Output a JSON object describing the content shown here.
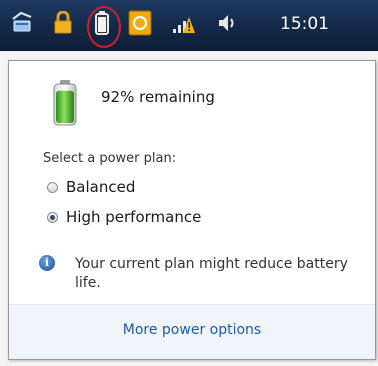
{
  "taskbar": {
    "clock": "15:01",
    "tray_icons": [
      "network-icon",
      "lock-icon",
      "battery-icon",
      "notification-icon",
      "signal-icon",
      "volume-icon"
    ]
  },
  "battery": {
    "status_text": "92% remaining",
    "charge_level": 0.92
  },
  "power_plans": {
    "label": "Select a power plan:",
    "options": [
      {
        "label": "Balanced",
        "selected": false
      },
      {
        "label": "High performance",
        "selected": true
      }
    ]
  },
  "info": {
    "message": "Your current plan might reduce battery life."
  },
  "footer": {
    "link_label": "More power options"
  },
  "colors": {
    "taskbar": "#142a4a",
    "link": "#1e5aa8",
    "highlight": "#d0202a",
    "battery_fill": "#4caf2e"
  }
}
